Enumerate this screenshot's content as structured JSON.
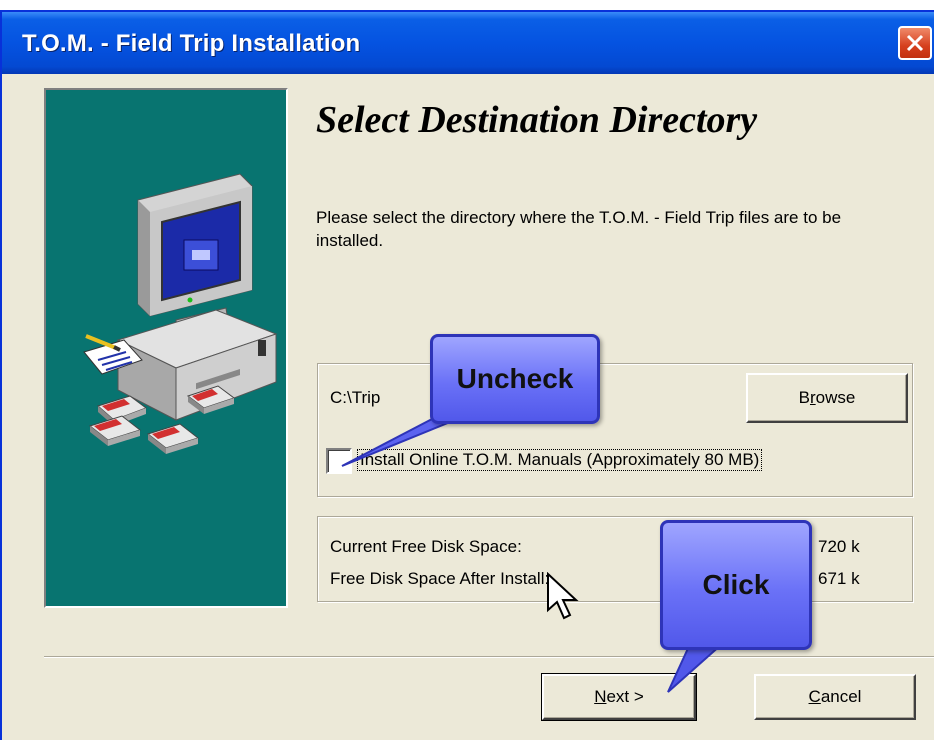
{
  "window": {
    "title": "T.O.M. - Field Trip Installation"
  },
  "side_panel": {
    "illustration": "computer-with-floppy-disks"
  },
  "page": {
    "heading": "Select Destination Directory",
    "instructions": "Please select the directory where the T.O.M. - Field Trip files are to be installed."
  },
  "destination": {
    "path": "C:\\Trip",
    "browse_label": "Browse",
    "manuals_checkbox_label": "Install Online T.O.M. Manuals (Approximately 80 MB)",
    "manuals_checked": false
  },
  "disk_space": {
    "current_label": "Current Free Disk Space:",
    "current_value": "720 k",
    "after_label": "Free Disk Space After Install:",
    "after_value": "671 k"
  },
  "buttons": {
    "next_label": "Next >",
    "cancel_label": "Cancel"
  },
  "annotations": {
    "uncheck_text": "Uncheck",
    "click_text": "Click"
  },
  "colors": {
    "titlebar": "#0553e1",
    "panel": "#087470",
    "window_bg": "#ece9d8",
    "callout": "#6a71f7"
  }
}
